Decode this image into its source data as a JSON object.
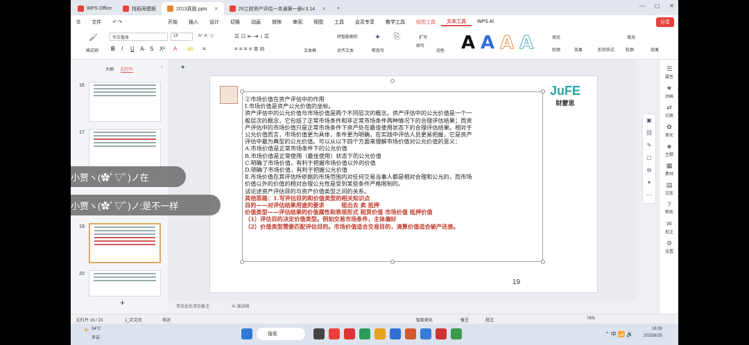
{
  "tabs": [
    {
      "label": "WPS Office",
      "color": "#e8403a"
    },
    {
      "label": "找稻壳模板",
      "color": "#e8403a"
    },
    {
      "label": "2013真题.pptx",
      "color": "#e6842a"
    },
    {
      "label": "26江财资产评估一本通第一册v.3.14",
      "color": "#e8403a"
    }
  ],
  "menu": {
    "file": "文件",
    "items": [
      "开始",
      "插入",
      "设计",
      "切换",
      "动画",
      "放映",
      "审阅",
      "视图",
      "工具",
      "会员专享",
      "教学工具",
      "绘图工具",
      "文本工具",
      "WPS AI"
    ],
    "share": "分享"
  },
  "ribbon": {
    "format_painter": "格式刷",
    "font": "华文楷体",
    "size": "18",
    "convert": "转智能图形",
    "text_box": "文本框",
    "align_text": "对齐文本",
    "help": "帮我写",
    "expand": "扩写",
    "continue": "续写",
    "polish": "润色",
    "style_label": "文本样式",
    "fill": "填充",
    "outline": "轮廓",
    "effect": "效果",
    "shape_style": "形状样式",
    "shape_fill": "填充",
    "shape_outline": "轮廓",
    "shape_effect": "效果"
  },
  "left": {
    "outline_tab": "大纲",
    "slides_tab": "幻灯片",
    "thumbs": [
      "16",
      "17",
      "19",
      "20"
    ],
    "add": "+"
  },
  "comments": [
    "小贾ヽ(✿ﾟ▽ﾟ)ノ在",
    "小贾ヽ(✿ﾟ▽ﾟ)ノ:是不一样"
  ],
  "slide": {
    "lines": [
      {
        "t": "②市场价值在资产评估中的作用",
        "c": "n"
      },
      {
        "t": "Ⅰ.市场价值是资产公允价值的坐标。",
        "c": "n"
      },
      {
        "t": "资产评估中的公允价值与市场价值是两个不同层次的概念。资产评估中的公允价值是一个一",
        "c": "n"
      },
      {
        "t": "般层次的概念，它包括了正常市场条件和非正常市场条件两种情况下的合理评估结果；而资",
        "c": "n"
      },
      {
        "t": "产评估中的市场价值只是正常市场条件下资产处在最佳使用状态下的合理评估结果。相对于",
        "c": "n"
      },
      {
        "t": "公允价值而言，市场价值更为具体，条件更为明确，在实践中评估人员更易把握，它是资产",
        "c": "n"
      },
      {
        "t": "评估中最为典型的公允价值。可以从以下四个方面来理解市场价值对公允价值的意义：",
        "c": "n"
      },
      {
        "t": "A.市场价值是正常市场条件下的公允价值",
        "c": "n"
      },
      {
        "t": "B.市场价值是正常使用（最佳使用）状态下的公允价值",
        "c": "n"
      },
      {
        "t": "C.明确了市场价值，有利于把握市场价值以外的价值",
        "c": "n"
      },
      {
        "t": "D.明确了市场价值，有利于把握公允价值",
        "c": "n"
      },
      {
        "t": "Ⅱ.市场价值在其评估所依据的市场范围内对任何交易当事人都是相对合理和公允的，而市场",
        "c": "n"
      },
      {
        "t": "价值以外的价值的相对合理公允性是受到某些条件严格限制的。",
        "c": "n"
      },
      {
        "t": "试论述资产评估目的与资产价值类型之间的关系。",
        "c": "n"
      },
      {
        "t": "其他思路：1.写评估目的和价值类型的相关知识点",
        "c": "r"
      },
      {
        "t": "目的——对评估结果用途的要求　　　租出去  卖  抵押",
        "c": "r"
      },
      {
        "t": "价值类型——评估结果的价值属性和表现形式  租赁价值  市场价值 抵押价值",
        "c": "r"
      },
      {
        "t": "（1）评估目的决定价值类型。例如交易市场条件，主体偏好",
        "c": "r"
      },
      {
        "t": "（2）价值类型需要匹配评估目的。市场价值适合交易目的，清算价值适合破产还债。",
        "c": "r"
      }
    ],
    "page": "19",
    "logo": "财蒙思"
  },
  "notes": "单击此处添加备注",
  "ai_speech": "AI 演讲稿",
  "right": [
    "属性",
    "动画",
    "切换",
    "美化",
    "主题",
    "素材",
    "文库",
    "帮助",
    "批注",
    "设置"
  ],
  "status": {
    "slide": "幻灯片 19 / 23",
    "theme": "1_正文页",
    "proof": "校对",
    "smart": "智能美化",
    "notes": "备注",
    "comment": "批注",
    "zoom": "76%"
  },
  "taskbar": {
    "weather_temp": "34°C",
    "weather_desc": "多云",
    "search": "搜索",
    "time": "16:30",
    "date": "2025/8/25"
  }
}
